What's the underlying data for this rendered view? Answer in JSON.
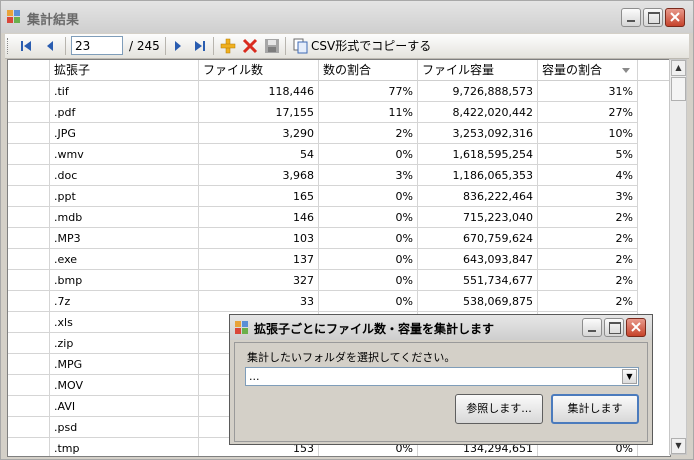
{
  "window": {
    "title": "集計結果"
  },
  "toolbar": {
    "position": "23",
    "of_count": "/ 245",
    "csv_label": "CSV形式でコピーする"
  },
  "table": {
    "columns": [
      "拡張子",
      "ファイル数",
      "数の割合",
      "ファイル容量",
      "容量の割合"
    ],
    "rows": [
      [
        ".tif",
        "118,446",
        "77%",
        "9,726,888,573",
        "31%"
      ],
      [
        ".pdf",
        "17,155",
        "11%",
        "8,422,020,442",
        "27%"
      ],
      [
        ".JPG",
        "3,290",
        "2%",
        "3,253,092,316",
        "10%"
      ],
      [
        ".wmv",
        "54",
        "0%",
        "1,618,595,254",
        "5%"
      ],
      [
        ".doc",
        "3,968",
        "3%",
        "1,186,065,353",
        "4%"
      ],
      [
        ".ppt",
        "165",
        "0%",
        "836,222,464",
        "3%"
      ],
      [
        ".mdb",
        "146",
        "0%",
        "715,223,040",
        "2%"
      ],
      [
        ".MP3",
        "103",
        "0%",
        "670,759,624",
        "2%"
      ],
      [
        ".exe",
        "137",
        "0%",
        "643,093,847",
        "2%"
      ],
      [
        ".bmp",
        "327",
        "0%",
        "551,734,677",
        "2%"
      ],
      [
        ".7z",
        "33",
        "0%",
        "538,069,875",
        "2%"
      ],
      [
        ".xls",
        "",
        "",
        "",
        ""
      ],
      [
        ".zip",
        "",
        "",
        "",
        ""
      ],
      [
        ".MPG",
        "",
        "",
        "",
        ""
      ],
      [
        ".MOV",
        "",
        "",
        "",
        ""
      ],
      [
        ".AVI",
        "",
        "",
        "",
        ""
      ],
      [
        ".psd",
        "",
        "",
        "",
        ""
      ],
      [
        ".tmp",
        "153",
        "0%",
        "134,294,651",
        "0%"
      ]
    ]
  },
  "dialog": {
    "title": "拡張子ごとにファイル数・容量を集計します",
    "label": "集計したいフォルダを選択してください。",
    "combo_value": "...",
    "browse_label": "参照します...",
    "run_label": "集計します"
  }
}
